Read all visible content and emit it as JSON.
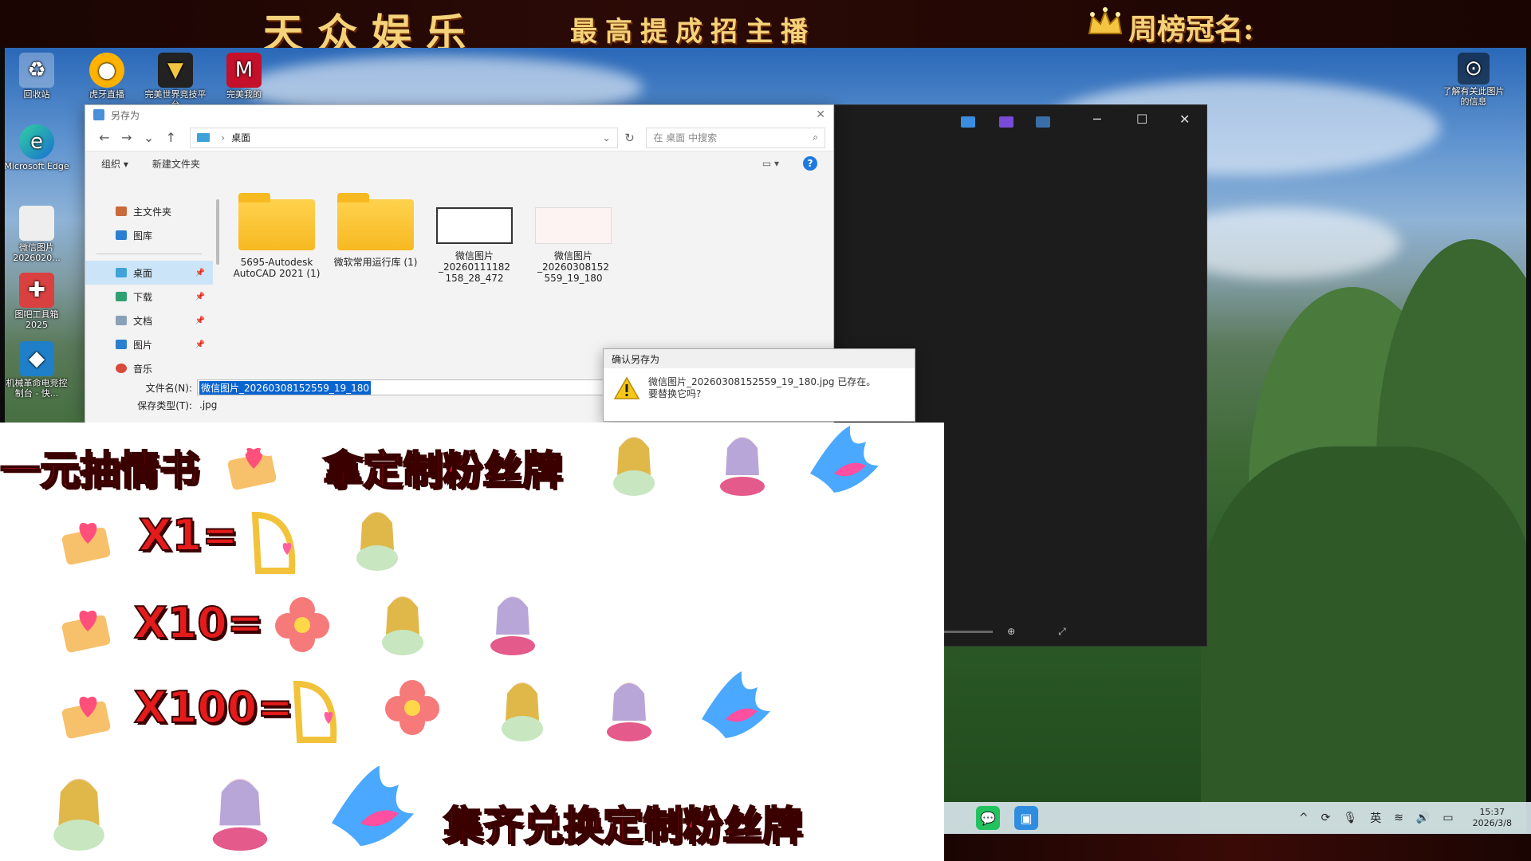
{
  "banner": {
    "left_title": "天众娱乐",
    "middle_title": "最高提成招主播",
    "right_title": "周榜冠名:"
  },
  "desktop_icons": [
    {
      "label": "回收站",
      "icon": "recycle-bin-icon"
    },
    {
      "label": "虎牙直播",
      "icon": "huya-icon"
    },
    {
      "label": "完美世界竞技平台",
      "icon": "perfect-world-icon"
    },
    {
      "label": "完美我的",
      "icon": "app-icon"
    },
    {
      "label": "Microsoft Edge",
      "icon": "edge-icon"
    },
    {
      "label": "微信图片 2026020...",
      "icon": "image-file-icon"
    },
    {
      "label": "图吧工具箱 2025",
      "icon": "toolbox-icon"
    },
    {
      "label": "机械革命电竞控制台 - 快...",
      "icon": "control-center-icon"
    }
  ],
  "desktop_right_icon": {
    "label": "了解有关此图片的信息",
    "icon": "info-camera-icon"
  },
  "save_dialog": {
    "title": "另存为",
    "address": "桌面",
    "search_placeholder": "在 桌面 中搜索",
    "toolbar": {
      "organize": "组织 ▾",
      "new_folder": "新建文件夹"
    },
    "sidebar": [
      {
        "label": "主文件夹",
        "icon": "home-icon"
      },
      {
        "label": "图库",
        "icon": "gallery-icon"
      },
      {
        "label": "桌面",
        "icon": "desktop-icon",
        "selected": true
      },
      {
        "label": "下载",
        "icon": "download-icon"
      },
      {
        "label": "文档",
        "icon": "document-icon"
      },
      {
        "label": "图片",
        "icon": "pictures-icon"
      },
      {
        "label": "音乐",
        "icon": "music-icon"
      }
    ],
    "files": [
      {
        "name": "5695-Autodesk AutoCAD 2021 (1)",
        "kind": "folder"
      },
      {
        "name": "微软常用运行库 (1)",
        "kind": "folder"
      },
      {
        "name": "微信图片 _20260111182 158_28_472",
        "kind": "image-blank"
      },
      {
        "name": "微信图片 _20260308152 559_19_180",
        "kind": "image-stickers"
      }
    ],
    "filename_label": "文件名(N):",
    "filename_value": "微信图片_20260308152559_19_180",
    "filetype_label": "保存类型(T):",
    "filetype_value": ".jpg"
  },
  "confirm_dialog": {
    "title": "确认另存为",
    "message_line1": "微信图片_20260308152559_19_180.jpg 已存在。",
    "message_line2": "要替换它吗?"
  },
  "viewer": {
    "zoom_fraction": 0.08
  },
  "taskbar": {
    "tray_ime": "英",
    "time": "15:37",
    "date": "2026/3/8"
  },
  "promo": {
    "headline_left": "一元抽情书",
    "headline_right": "拿定制粉丝牌",
    "x1": "X1=",
    "x10": "X10=",
    "x100": "X100=",
    "footer": "集齐兑换定制粉丝牌"
  },
  "colors": {
    "promo_red": "#e41b1b",
    "banner_gold": "#f4d27a",
    "selection_blue": "#0a64d0"
  }
}
